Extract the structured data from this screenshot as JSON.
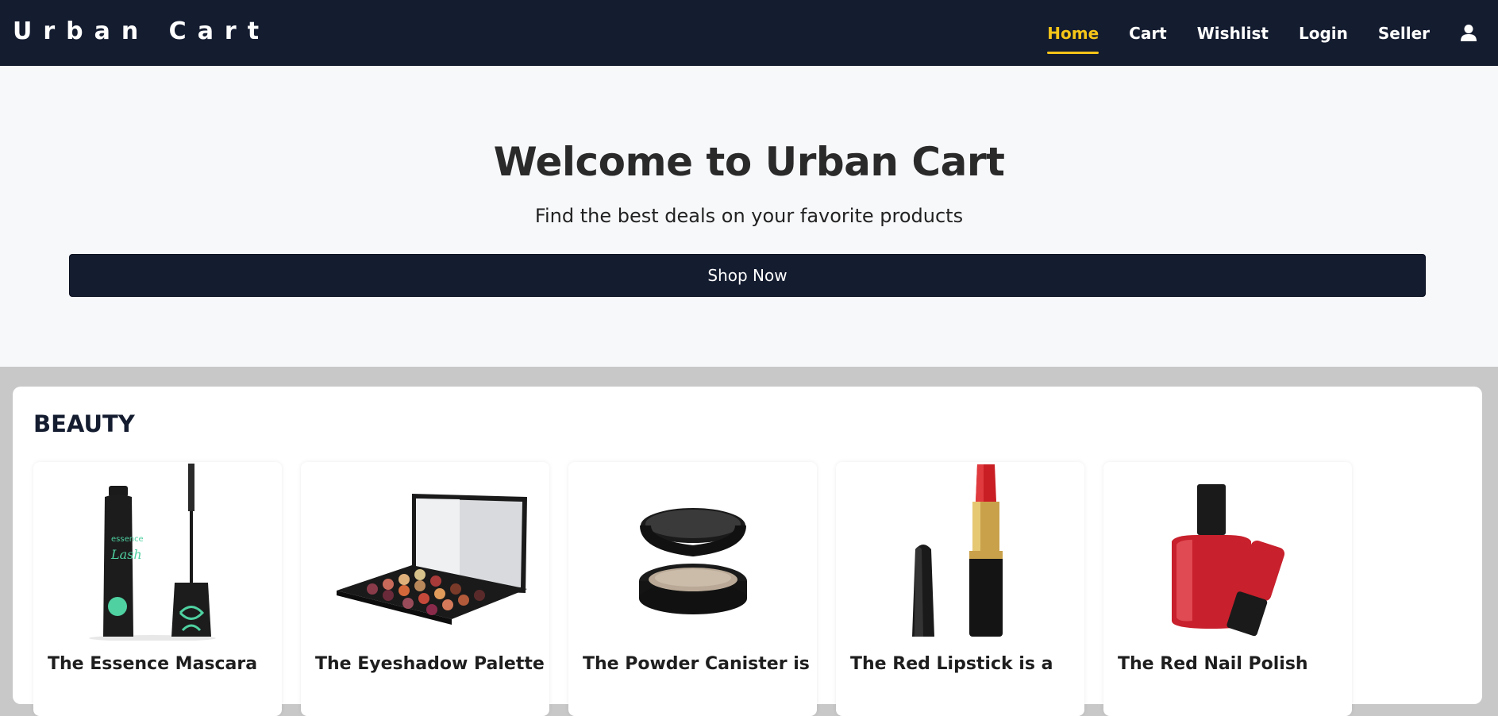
{
  "brand": "Urban Cart",
  "nav": {
    "items": [
      {
        "label": "Home",
        "active": true
      },
      {
        "label": "Cart"
      },
      {
        "label": "Wishlist"
      },
      {
        "label": "Login"
      },
      {
        "label": "Seller"
      }
    ],
    "user_icon": "user-icon"
  },
  "hero": {
    "title": "Welcome to Urban Cart",
    "subtitle": "Find the best deals on your favorite products",
    "button_label": "Shop Now"
  },
  "category": {
    "title": "BEAUTY",
    "products": [
      {
        "name": "The Essence Mascara",
        "image": "mascara"
      },
      {
        "name": "The Eyeshadow Palette",
        "image": "eyeshadow-palette"
      },
      {
        "name": "The Powder Canister is",
        "image": "powder-canister"
      },
      {
        "name": "The Red Lipstick is a",
        "image": "red-lipstick"
      },
      {
        "name": "The Red Nail Polish",
        "image": "red-nail-polish"
      }
    ]
  },
  "colors": {
    "navbar": "#141c30",
    "accent": "#f5c518",
    "hero_bg": "#f7f8fa",
    "page_bg": "#c8c8c8"
  }
}
